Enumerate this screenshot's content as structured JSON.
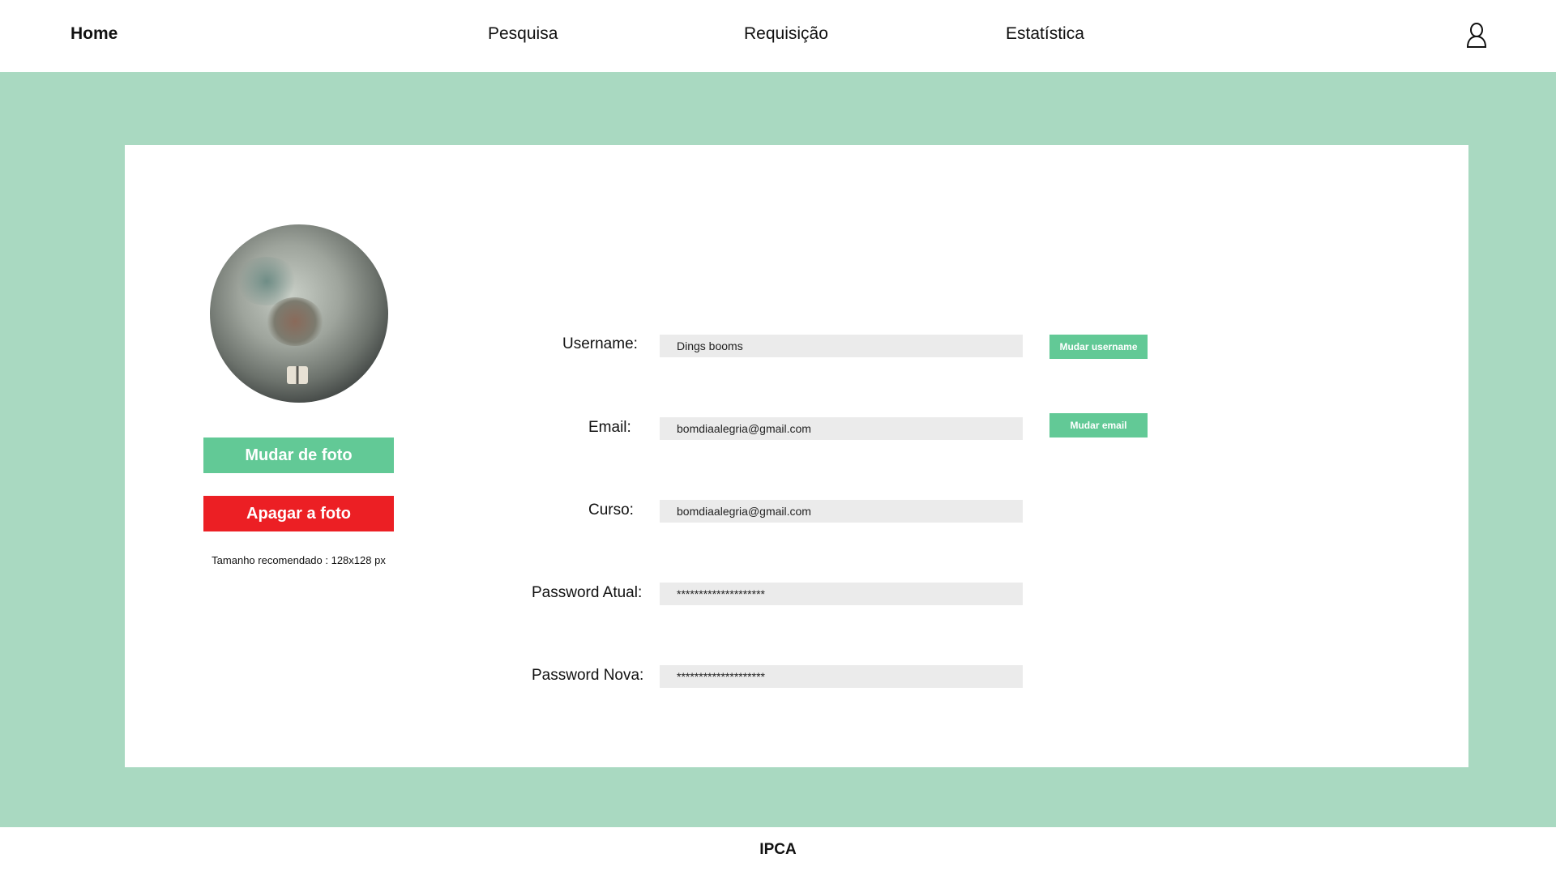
{
  "nav": {
    "home": "Home",
    "pesquisa": "Pesquisa",
    "requisicao": "Requisição",
    "estatistica": "Estatística",
    "user_icon": "user-icon"
  },
  "profile": {
    "change_photo_label": "Mudar de foto",
    "delete_photo_label": "Apagar a foto",
    "photo_hint": "Tamanho recomendado : 128x128 px"
  },
  "form": {
    "username": {
      "label": "Username:",
      "value": "Dings booms",
      "button": "Mudar username"
    },
    "email": {
      "label": "Email:",
      "value": "bomdiaalegria@gmail.com",
      "button": "Mudar email"
    },
    "curso": {
      "label": "Curso:",
      "value": "bomdiaalegria@gmail.com"
    },
    "password_atual": {
      "label": "Password Atual:",
      "value": "********************"
    },
    "password_nova": {
      "label": "Password Nova:",
      "value": "********************"
    }
  },
  "footer": {
    "text": "IPCA"
  },
  "colors": {
    "background_green": "#a9d9c1",
    "accent_green": "#62c996",
    "danger_red": "#ec1f24",
    "input_bg": "#ebebeb"
  }
}
